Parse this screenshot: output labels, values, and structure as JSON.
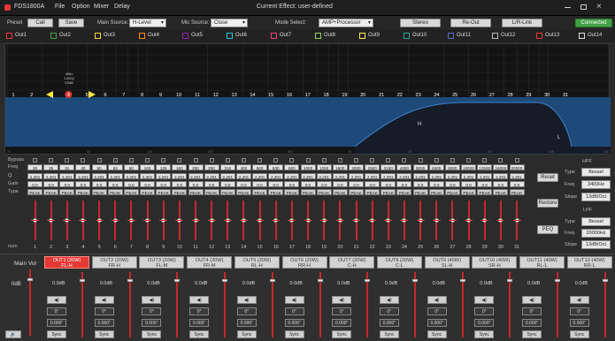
{
  "title_bar": {
    "app_name": "FDS1800A",
    "menu": [
      "File",
      "Option",
      "Mixer",
      "Delay"
    ],
    "effect_title": "Current Effect: user-defined"
  },
  "toolbar": {
    "preset_label": "Preset",
    "call_label": "Call",
    "save_label": "Save",
    "main_source_label": "Main Source:",
    "main_source_value": "H-Level",
    "mic_source_label": "Mic Source:",
    "mic_source_value": "Close",
    "mode_select_label": "Mode Select:",
    "mode_select_value": "AMP+Processor",
    "stereo_label": "Stereo",
    "reout_label": "Re-Out",
    "lrlink_label": "L/R-Link",
    "connected_label": "Connected"
  },
  "channels": [
    {
      "name": "Out1",
      "color": "#e53935"
    },
    {
      "name": "Out2",
      "color": "#43a047"
    },
    {
      "name": "Out3",
      "color": "#fdd835"
    },
    {
      "name": "Out4",
      "color": "#fb8c00"
    },
    {
      "name": "Out5",
      "color": "#8e24aa"
    },
    {
      "name": "Out6",
      "color": "#26c6da"
    },
    {
      "name": "Out7",
      "color": "#ec407a"
    },
    {
      "name": "Out8",
      "color": "#9ccc65"
    },
    {
      "name": "Out9",
      "color": "#ffee58"
    },
    {
      "name": "Out10",
      "color": "#26a69a"
    },
    {
      "name": "Out11",
      "color": "#5c6bc0"
    },
    {
      "name": "Out12",
      "color": "#bdbdbd"
    },
    {
      "name": "Out13",
      "color": "#e53935"
    },
    {
      "name": "Out14",
      "color": "#dddddd"
    }
  ],
  "graph": {
    "point_numbers": [
      "1",
      "2",
      "3",
      "4",
      "5",
      "6",
      "7",
      "8",
      "9",
      "10",
      "11",
      "12",
      "13",
      "14",
      "15",
      "16",
      "17",
      "18",
      "19",
      "20",
      "21",
      "22",
      "23",
      "24",
      "25",
      "26",
      "27",
      "28",
      "29",
      "30",
      "31"
    ],
    "selected_point": "4",
    "point_info": [
      "40Hz",
      "2.201Q",
      "0.0dB"
    ],
    "h_marker": "H",
    "l_marker": "L",
    "x_axis_labels": [
      "20",
      "50",
      "100",
      "200",
      "500",
      "1K",
      "2K",
      "5K",
      "10K",
      "20K"
    ]
  },
  "eq_rows": {
    "labels": [
      "Bypass",
      "Freq",
      "Q",
      "Gain",
      "Type"
    ],
    "freqs": [
      "20",
      "25",
      "31",
      "40",
      "50",
      "63",
      "80",
      "100",
      "125",
      "160",
      "200",
      "250",
      "315",
      "400",
      "500",
      "630",
      "800",
      "1000",
      "1250",
      "1600",
      "2000",
      "2500",
      "3150",
      "4000",
      "5000",
      "6300",
      "8000",
      "10000",
      "12500",
      "16000",
      "20000"
    ],
    "q_value": "2.201",
    "gain_value": "0.0",
    "type_value": "PEAK",
    "num_label": "num"
  },
  "right_panel": {
    "reset_label": "Reset",
    "restore_label": "Restore",
    "peq_label": "PEQ",
    "hpf_title": "HPF",
    "hpf_type_label": "Type",
    "hpf_type_value": "Bessel",
    "hpf_freq_label": "Freq",
    "hpf_freq_value": "3400Hz",
    "hpf_slope_label": "Slope",
    "hpf_slope_value": "12dB/Oct",
    "lpf_title": "LPF",
    "lpf_type_label": "Type",
    "lpf_type_value": "Bessel",
    "lpf_freq_label": "Freq",
    "lpf_freq_value": "20000Hz",
    "lpf_slope_label": "Slope",
    "lpf_slope_value": "12dB/Oct"
  },
  "mixer": {
    "main_vol_label": "Main Vol",
    "main_vol_value": "0dB",
    "outputs": [
      {
        "name": "OUT1 (20W)",
        "role": "FL-H",
        "gain": "0.0dB",
        "phase": "0°",
        "delay": "0.000\"",
        "sync": "Sync"
      },
      {
        "name": "OUT2 (20W)",
        "role": "FR-H",
        "gain": "0.0dB",
        "phase": "0°",
        "delay": "0.000\"",
        "sync": "Sync"
      },
      {
        "name": "OUT3 (20W)",
        "role": "FL-M",
        "gain": "0.0dB",
        "phase": "0°",
        "delay": "0.000\"",
        "sync": "Sync"
      },
      {
        "name": "OUT4 (20W)",
        "role": "FR-M",
        "gain": "0.0dB",
        "phase": "0°",
        "delay": "0.000\"",
        "sync": "Sync"
      },
      {
        "name": "OUT5 (20W)",
        "role": "RL-H",
        "gain": "0.0dB",
        "phase": "0°",
        "delay": "0.000\"",
        "sync": "Sync"
      },
      {
        "name": "OUT6 (20W)",
        "role": "RR-H",
        "gain": "0.0dB",
        "phase": "0°",
        "delay": "0.000\"",
        "sync": "Sync"
      },
      {
        "name": "OUT7 (20W)",
        "role": "C-H",
        "gain": "0.0dB",
        "phase": "0°",
        "delay": "0.000\"",
        "sync": "Sync"
      },
      {
        "name": "OUT8 (20W)",
        "role": "C-L",
        "gain": "0.0dB",
        "phase": "0°",
        "delay": "0.000\"",
        "sync": "Sync"
      },
      {
        "name": "OUT9 (40W)",
        "role": "SL-H",
        "gain": "0.0dB",
        "phase": "0°",
        "delay": "0.000\"",
        "sync": "Sync"
      },
      {
        "name": "OUT10 (40W)",
        "role": "SR-H",
        "gain": "0.0dB",
        "phase": "0°",
        "delay": "0.000\"",
        "sync": "Sync"
      },
      {
        "name": "OUT11 (40W)",
        "role": "RL-L",
        "gain": "0.0dB",
        "phase": "0°",
        "delay": "0.000\"",
        "sync": "Sync"
      },
      {
        "name": "OUT12 (40W)",
        "role": "RR-L",
        "gain": "0.0dB",
        "phase": "0°",
        "delay": "0.000\"",
        "sync": "Sync"
      }
    ]
  },
  "colors": {
    "accent_red": "#e53935",
    "connected_green": "#43a047",
    "graph_band_blue": "#1e4a7a",
    "graph_curve": "#3f7fc8"
  }
}
